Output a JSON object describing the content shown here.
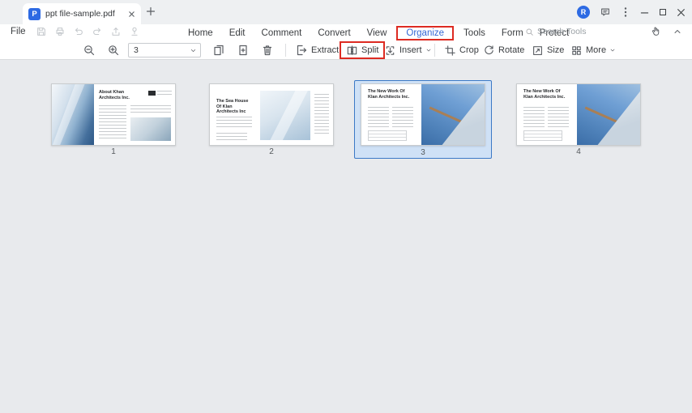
{
  "titlebar": {
    "tab_title": "ppt file-sample.pdf",
    "avatar_letter": "R"
  },
  "menubar": {
    "file_label": "File",
    "tabs": {
      "home": "Home",
      "edit": "Edit",
      "comment": "Comment",
      "convert": "Convert",
      "view": "View",
      "organize": "Organize",
      "tools": "Tools",
      "form": "Form",
      "protect": "Protect"
    },
    "search_label": "Search Tools"
  },
  "toolbar": {
    "page_number": "3",
    "extract_label": "Extract",
    "split_label": "Split",
    "insert_label": "Insert",
    "crop_label": "Crop",
    "rotate_label": "Rotate",
    "size_label": "Size",
    "more_label": "More"
  },
  "thumbnails": {
    "pages": [
      {
        "number": "1",
        "title": "About Khan Architects Inc.",
        "selected": false
      },
      {
        "number": "2",
        "title": "The Sea House Of Klan Architects Inc",
        "selected": false
      },
      {
        "number": "3",
        "title": "The New Work Of Klan Architects Inc.",
        "selected": true
      },
      {
        "number": "4",
        "title": "The New Work Of Klan Architects Inc.",
        "selected": false
      }
    ]
  },
  "colors": {
    "accent_blue": "#2d6ae3",
    "annotation_red": "#dd2b22",
    "selected_fill": "#cfe1f6",
    "selected_border": "#3c79c6"
  }
}
